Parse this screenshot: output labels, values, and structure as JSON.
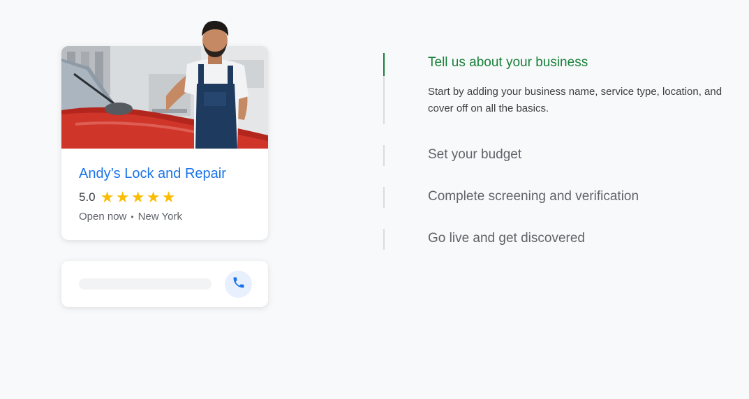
{
  "business_card": {
    "name": "Andy’s Lock and Repair",
    "rating": "5.0",
    "stars": [
      "★",
      "★",
      "★",
      "★",
      "★"
    ],
    "status": "Open now",
    "separator": "•",
    "location": "New York",
    "photo_icon": "mechanic-polishing-car-photo"
  },
  "call_card": {
    "call_icon": "phone-icon"
  },
  "steps": [
    {
      "title": "Tell us about your business",
      "description": "Start by adding your business name, service type, location, and cover off on all the basics.",
      "active": true
    },
    {
      "title": "Set your budget",
      "active": false
    },
    {
      "title": "Complete screening and verification",
      "active": false
    },
    {
      "title": "Go live and get discovered",
      "active": false
    }
  ],
  "colors": {
    "accent_green": "#188038",
    "link_blue": "#1a73e8",
    "star_yellow": "#fbbc04",
    "background": "#f8f9fb"
  }
}
